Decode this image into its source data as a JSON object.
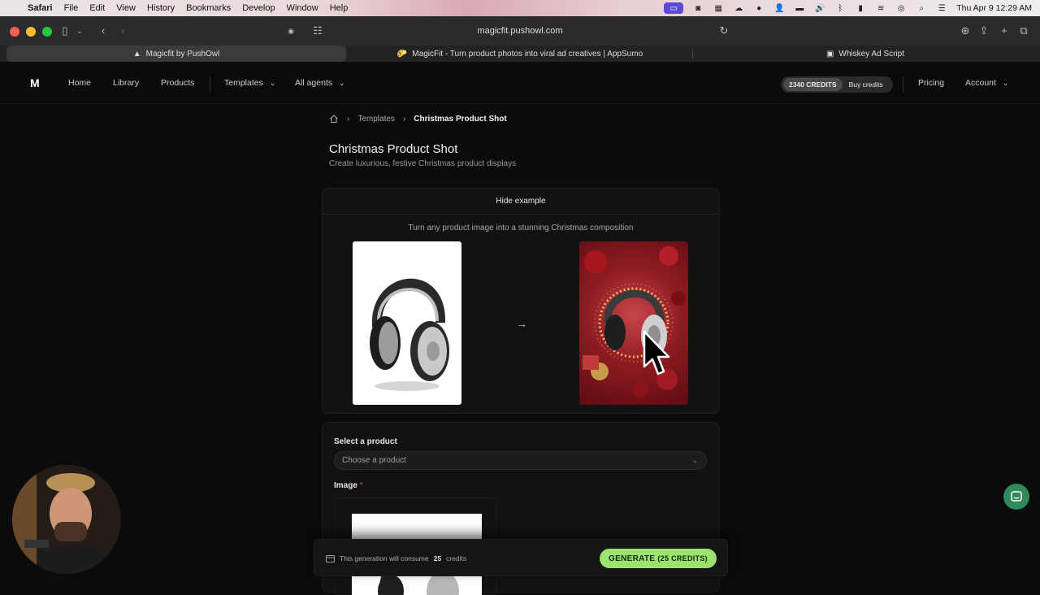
{
  "menubar": {
    "app": "Safari",
    "items": [
      "File",
      "Edit",
      "View",
      "History",
      "Bookmarks",
      "Develop",
      "Window",
      "Help"
    ],
    "datetime": "Thu Apr 9  12:29 AM"
  },
  "browser": {
    "url": "magicfit.pushowl.com",
    "tabs": [
      {
        "label": "Magicfit by PushOwl",
        "active": true
      },
      {
        "label": "MagicFit - Turn product photos into viral ad creatives | AppSumo",
        "active": false
      },
      {
        "label": "Whiskey Ad Script",
        "active": false
      }
    ]
  },
  "nav": {
    "logo_text": "M",
    "home": "Home",
    "library": "Library",
    "products": "Products",
    "templates": "Templates",
    "all_agents": "All agents",
    "credits": "2340 CREDITS",
    "buy_credits": "Buy credits",
    "pricing": "Pricing",
    "account": "Account"
  },
  "breadcrumb": {
    "templates": "Templates",
    "current": "Christmas Product Shot"
  },
  "page": {
    "title": "Christmas Product Shot",
    "subtitle": "Create luxurious, festive Christmas product displays"
  },
  "example": {
    "toggle": "Hide example",
    "caption": "Turn any product image into a stunning Christmas composition"
  },
  "form": {
    "product_label": "Select a product",
    "product_placeholder": "Choose a product",
    "image_label": "Image",
    "required_mark": "*"
  },
  "generate": {
    "info_prefix": "This generation will consume",
    "info_amount": "25",
    "info_suffix": "credits",
    "button": "GENERATE",
    "button_credits": "(25 CREDITS)"
  },
  "colors": {
    "accent": "#9be36e",
    "chat": "#2f8a5b",
    "background": "#0b0b0b"
  }
}
